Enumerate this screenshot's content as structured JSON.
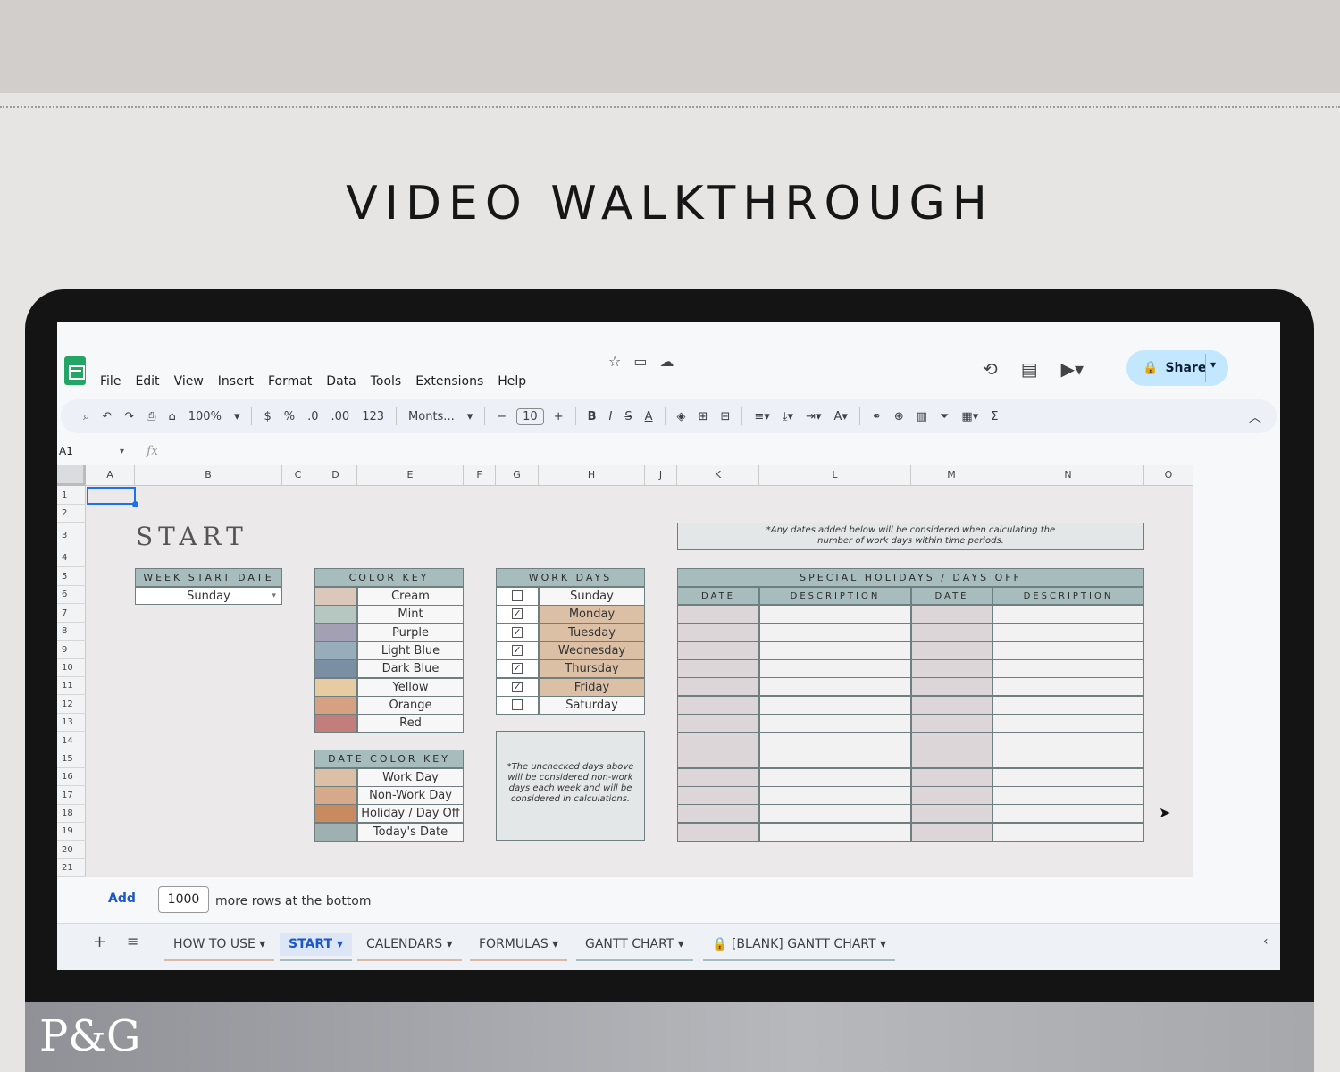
{
  "headline": "VIDEO WALKTHROUGH",
  "brand": "P&G",
  "menu": [
    "File",
    "Edit",
    "View",
    "Insert",
    "Format",
    "Data",
    "Tools",
    "Extensions",
    "Help"
  ],
  "share_label": "Share",
  "toolbar": {
    "zoom": "100%",
    "currency": "$",
    "percent": "%",
    "dec_less": ".0",
    "dec_more": ".00",
    "number_format": "123",
    "font": "Monts...",
    "font_size": "10"
  },
  "namebox": "A1",
  "fx": "fx",
  "columns": [
    "A",
    "B",
    "C",
    "D",
    "E",
    "F",
    "G",
    "H",
    "J",
    "K",
    "L",
    "M",
    "N",
    "O"
  ],
  "rows": [
    "1",
    "2",
    "3",
    "4",
    "5",
    "6",
    "7",
    "8",
    "9",
    "10",
    "11",
    "12",
    "13",
    "14",
    "15",
    "16",
    "17",
    "18",
    "19",
    "20",
    "21"
  ],
  "start_title": "START",
  "week_start": {
    "header": "WEEK START DATE",
    "value": "Sunday"
  },
  "color_key": {
    "header": "COLOR KEY",
    "items": [
      {
        "label": "Cream",
        "color": "#dcc8bb"
      },
      {
        "label": "Mint",
        "color": "#b6c7c2"
      },
      {
        "label": "Purple",
        "color": "#a3a0b4"
      },
      {
        "label": "Light Blue",
        "color": "#98adbb"
      },
      {
        "label": "Dark Blue",
        "color": "#7b8fa4"
      },
      {
        "label": "Yellow",
        "color": "#e6cba3"
      },
      {
        "label": "Orange",
        "color": "#d6a182"
      },
      {
        "label": "Red",
        "color": "#c27d7d"
      }
    ]
  },
  "date_color_key": {
    "header": "DATE COLOR KEY",
    "items": [
      {
        "label": "Work Day",
        "color": "#dcc0a6"
      },
      {
        "label": "Non-Work Day",
        "color": "#d5a98a"
      },
      {
        "label": "Holiday / Day Off",
        "color": "#c98a60"
      },
      {
        "label": "Today's Date",
        "color": "#9fb0b0"
      }
    ]
  },
  "work_days": {
    "header": "WORK DAYS",
    "days": [
      {
        "label": "Sunday",
        "checked": false
      },
      {
        "label": "Monday",
        "checked": true
      },
      {
        "label": "Tuesday",
        "checked": true
      },
      {
        "label": "Wednesday",
        "checked": true
      },
      {
        "label": "Thursday",
        "checked": true
      },
      {
        "label": "Friday",
        "checked": true
      },
      {
        "label": "Saturday",
        "checked": false
      }
    ],
    "note": "*The unchecked days above will be considered non-work days each week and will be considered in calculations."
  },
  "holidays": {
    "note": "*Any dates added below will be considered when calculating the number of work days within time periods.",
    "header": "SPECIAL HOLIDAYS / DAYS OFF",
    "columns": [
      "DATE",
      "DESCRIPTION",
      "DATE",
      "DESCRIPTION"
    ]
  },
  "add_rows": {
    "button": "Add",
    "count": "1000",
    "suffix": "more rows at the bottom"
  },
  "sheet_tabs": [
    {
      "label": "HOW TO USE",
      "color": "#d8b9a3"
    },
    {
      "label": "START",
      "color": "#a7bcbc"
    },
    {
      "label": "CALENDARS",
      "color": "#d8b9a3"
    },
    {
      "label": "FORMULAS",
      "color": "#d8b9a3"
    },
    {
      "label": "GANTT CHART",
      "color": "#a7bcbc"
    },
    {
      "label": "[BLANK] GANTT CHART",
      "color": "#a7bcbc"
    }
  ]
}
